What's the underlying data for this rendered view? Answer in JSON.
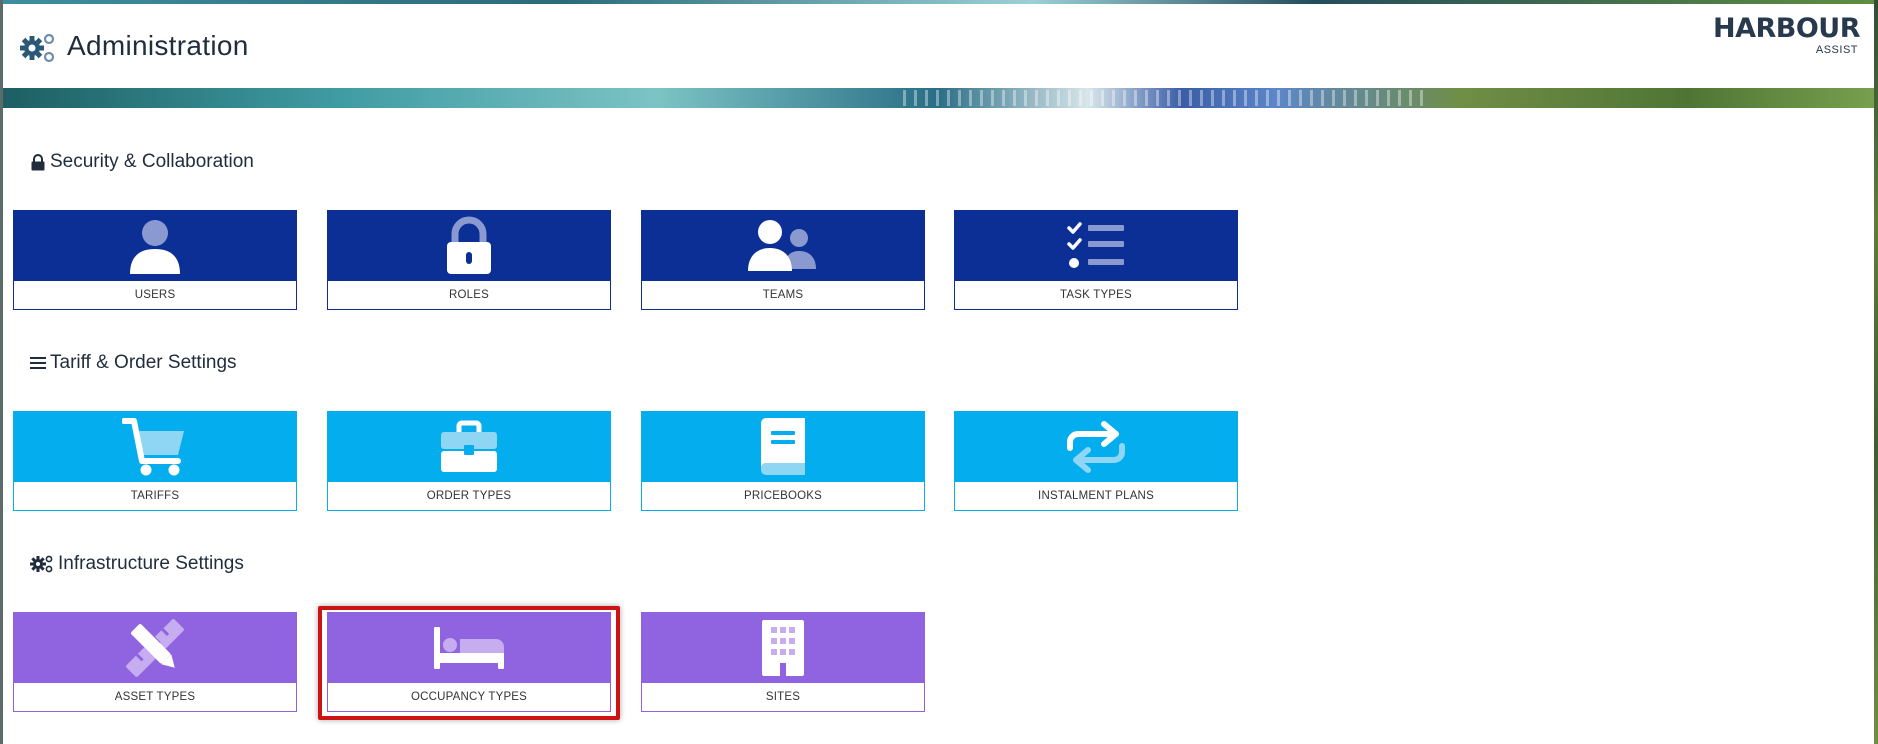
{
  "header": {
    "title": "Administration",
    "logo_text": "HARBOUR",
    "logo_subtext": "ASSIST"
  },
  "colors": {
    "security_tiles": "#0b2f94",
    "tariff_tiles": "#04aeee",
    "infrastructure_tiles": "#9064e1",
    "highlight": "#cc1414"
  },
  "sections": [
    {
      "heading": "Security & Collaboration",
      "icon": "lock-icon",
      "tiles": [
        {
          "label": "USERS",
          "icon": "user-icon"
        },
        {
          "label": "ROLES",
          "icon": "padlock-icon"
        },
        {
          "label": "TEAMS",
          "icon": "users-group-icon"
        },
        {
          "label": "TASK TYPES",
          "icon": "task-list-icon"
        }
      ]
    },
    {
      "heading": "Tariff & Order Settings",
      "icon": "list-lines-icon",
      "tiles": [
        {
          "label": "TARIFFS",
          "icon": "shopping-cart-icon"
        },
        {
          "label": "ORDER TYPES",
          "icon": "briefcase-icon"
        },
        {
          "label": "PRICEBOOKS",
          "icon": "book-icon"
        },
        {
          "label": "INSTALMENT PLANS",
          "icon": "repeat-icon"
        }
      ]
    },
    {
      "heading": "Infrastructure Settings",
      "icon": "cogs-icon",
      "tiles": [
        {
          "label": "ASSET TYPES",
          "icon": "pencil-ruler-icon"
        },
        {
          "label": "OCCUPANCY TYPES",
          "icon": "bed-icon",
          "highlighted": true
        },
        {
          "label": "SITES",
          "icon": "building-icon"
        }
      ]
    }
  ]
}
